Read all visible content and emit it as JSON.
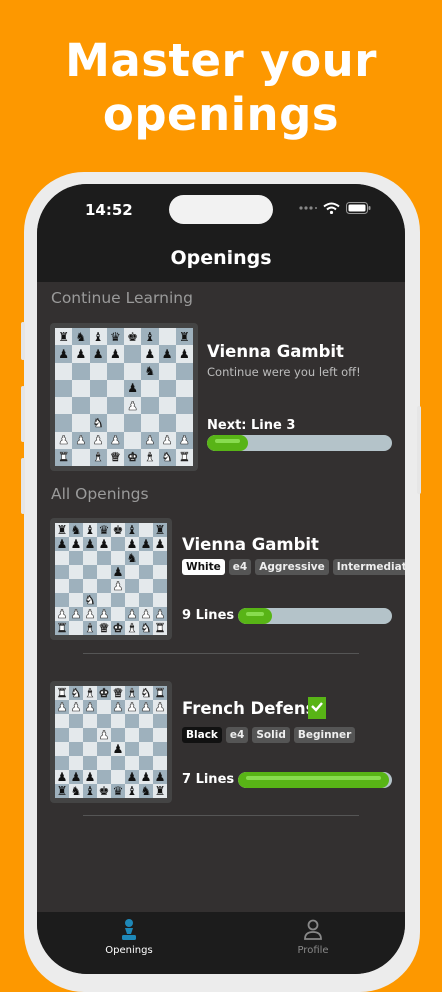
{
  "headline": {
    "line1": "Master your",
    "line2": "openings"
  },
  "status": {
    "time": "14:52"
  },
  "nav": {
    "title": "Openings"
  },
  "continue": {
    "section": "Continue Learning",
    "card": {
      "title": "Vienna Gambit",
      "subtitle": "Continue were you left off!",
      "next": "Next: Line 3",
      "progress": 0.22,
      "board": [
        "rnbqkb.r",
        "pppp.ppp",
        ".....n..",
        "....p...",
        "....P...",
        "..N.....",
        "PPPP.PPP",
        "R.BQKBNR"
      ]
    }
  },
  "all": {
    "section": "All Openings",
    "items": [
      {
        "title": "Vienna Gambit",
        "tags": [
          "White",
          "e4",
          "Aggressive",
          "Intermediate"
        ],
        "lines": "9 Lines",
        "progress": 0.22,
        "color": "white",
        "board": [
          "rnbqkb.r",
          "pppp.ppp",
          ".....n..",
          "....p...",
          "....P...",
          "..N.....",
          "PPPP.PPP",
          "R.BQKBNR"
        ]
      },
      {
        "title": "French Defense",
        "tags": [
          "Black",
          "e4",
          "Solid",
          "Beginner"
        ],
        "lines": "7 Lines",
        "progress": 0.98,
        "color": "black",
        "completed": true,
        "board": [
          "RNBKQBNR",
          "PPP.PPPP",
          "........",
          "...P....",
          "....p...",
          "........",
          "ppp..ppp",
          "rnbkqbnr"
        ]
      }
    ]
  },
  "tabs": [
    {
      "label": "Openings",
      "icon": "pawn-icon",
      "active": true
    },
    {
      "label": "Profile",
      "icon": "user-icon",
      "active": false
    }
  ],
  "colors": {
    "background": "#fd9800",
    "accent": "#58b416",
    "tab_active": "#1e88b8",
    "progress_track": "#b4c3c9"
  }
}
